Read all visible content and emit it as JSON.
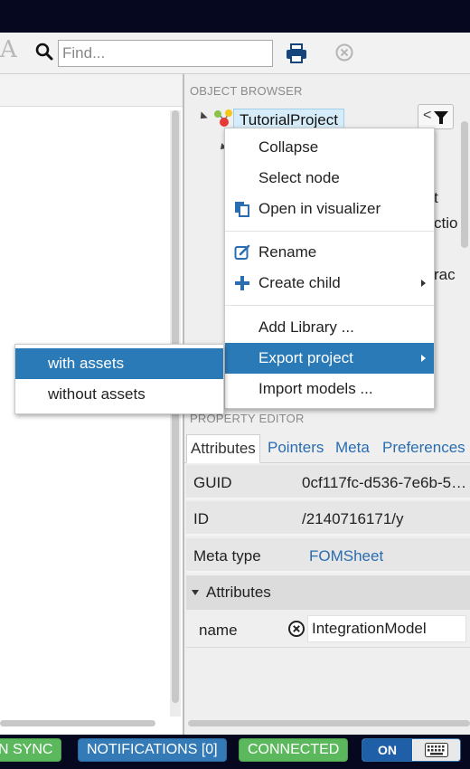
{
  "toolbar": {
    "font_glyph": "A",
    "search_placeholder": "Find...",
    "icons": [
      "search-icon",
      "printer-icon",
      "clear-icon"
    ]
  },
  "object_browser": {
    "title": "OBJECT BROWSER",
    "root_node": "TutorialProject",
    "collapse_glyph": "<",
    "partial_texts": [
      "t",
      "ctio",
      "rac"
    ]
  },
  "context_menu": {
    "items": [
      {
        "label": "Collapse",
        "icon": ""
      },
      {
        "label": "Select node",
        "icon": ""
      },
      {
        "label": "Open in visualizer",
        "icon": "copy-icon"
      },
      {
        "label": "Rename",
        "icon": "edit-icon"
      },
      {
        "label": "Create child",
        "icon": "plus-icon",
        "has_submenu": true
      },
      {
        "label": "Add Library ...",
        "icon": ""
      },
      {
        "label": "Export project",
        "icon": "",
        "has_submenu": true,
        "active": true
      },
      {
        "label": "Import models ...",
        "icon": ""
      }
    ],
    "submenu": [
      {
        "label": "with assets",
        "active": true
      },
      {
        "label": "without assets"
      }
    ]
  },
  "property_editor": {
    "title": "PROPERTY EDITOR",
    "tabs": [
      {
        "label": "Attributes",
        "active": true
      },
      {
        "label": "Pointers"
      },
      {
        "label": "Meta"
      },
      {
        "label": "Preferences"
      }
    ],
    "rows": [
      {
        "label": "GUID",
        "value": "0cf117fc-d536-7e6b-5…"
      },
      {
        "label": "ID",
        "value": "/2140716171/y"
      },
      {
        "label": "Meta type",
        "value": "FOMSheet"
      }
    ],
    "group_label": "Attributes",
    "attribute": {
      "name": "name",
      "value": "IntegrationModel"
    }
  },
  "statusbar": {
    "chips": [
      "N SYNC",
      "NOTIFICATIONS [0]",
      "CONNECTED"
    ],
    "toggle_label": "ON",
    "colors": {
      "green": "#5cb85c",
      "blue": "#337ab7",
      "bar": "#05081f"
    }
  }
}
